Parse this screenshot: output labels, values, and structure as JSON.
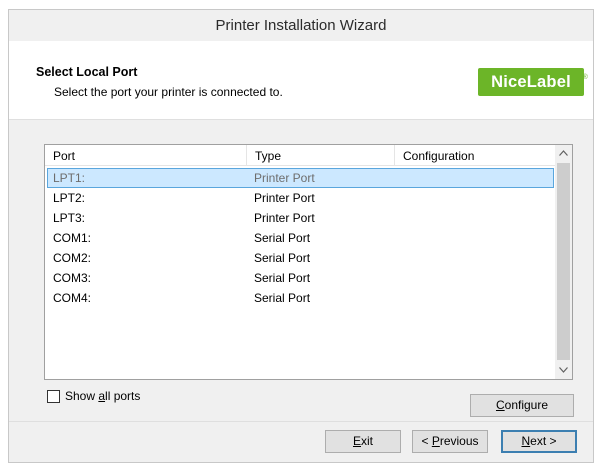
{
  "window": {
    "title": "Printer Installation Wizard"
  },
  "header": {
    "title": "Select Local Port",
    "subtitle": "Select the port your printer is connected to.",
    "logo_text_nice": "Nice",
    "logo_text_label": "Label",
    "logo_mark": "®",
    "brand_color": "#6cb528"
  },
  "table": {
    "columns": [
      "Port",
      "Type",
      "Configuration"
    ],
    "rows": [
      {
        "port": "LPT1:",
        "type": "Printer Port",
        "configuration": ""
      },
      {
        "port": "LPT2:",
        "type": "Printer Port",
        "configuration": ""
      },
      {
        "port": "LPT3:",
        "type": "Printer Port",
        "configuration": ""
      },
      {
        "port": "COM1:",
        "type": "Serial Port",
        "configuration": ""
      },
      {
        "port": "COM2:",
        "type": "Serial Port",
        "configuration": ""
      },
      {
        "port": "COM3:",
        "type": "Serial Port",
        "configuration": ""
      },
      {
        "port": "COM4:",
        "type": "Serial Port",
        "configuration": ""
      }
    ],
    "selected_index": 0,
    "selection_color": "#cce8ff",
    "scroll_up_icon": "chevron-up-icon",
    "scroll_down_icon": "chevron-down-icon"
  },
  "options": {
    "show_all_ports_prefix": "Show ",
    "show_all_ports_accel": "a",
    "show_all_ports_suffix": "ll ports",
    "show_all_ports_checked": false
  },
  "buttons": {
    "configure_accel": "C",
    "configure_rest": "onfigure",
    "exit_accel": "E",
    "exit_rest": "xit",
    "previous_prefix": "< ",
    "previous_accel": "P",
    "previous_rest": "revious",
    "next_accel": "N",
    "next_rest": "ext >"
  }
}
